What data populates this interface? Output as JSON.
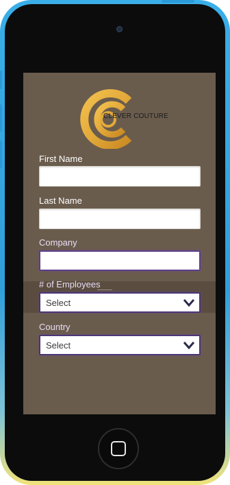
{
  "brand": {
    "name": "CLEVER COUTURE",
    "colors": {
      "logo_gold": "#e3a93a",
      "screen_bg": "#6a5c4d",
      "focus_border": "#4b3577"
    }
  },
  "form": {
    "first_name": {
      "label": "First Name",
      "value": ""
    },
    "last_name": {
      "label": "Last Name",
      "value": ""
    },
    "company": {
      "label": "Company",
      "value": ""
    },
    "employees": {
      "label": "# of Employees",
      "selected": "Select"
    },
    "country": {
      "label": "Country",
      "selected": "Select"
    }
  },
  "icons": {
    "home": "home-button-icon",
    "dropdown": "chevron-down-icon"
  }
}
